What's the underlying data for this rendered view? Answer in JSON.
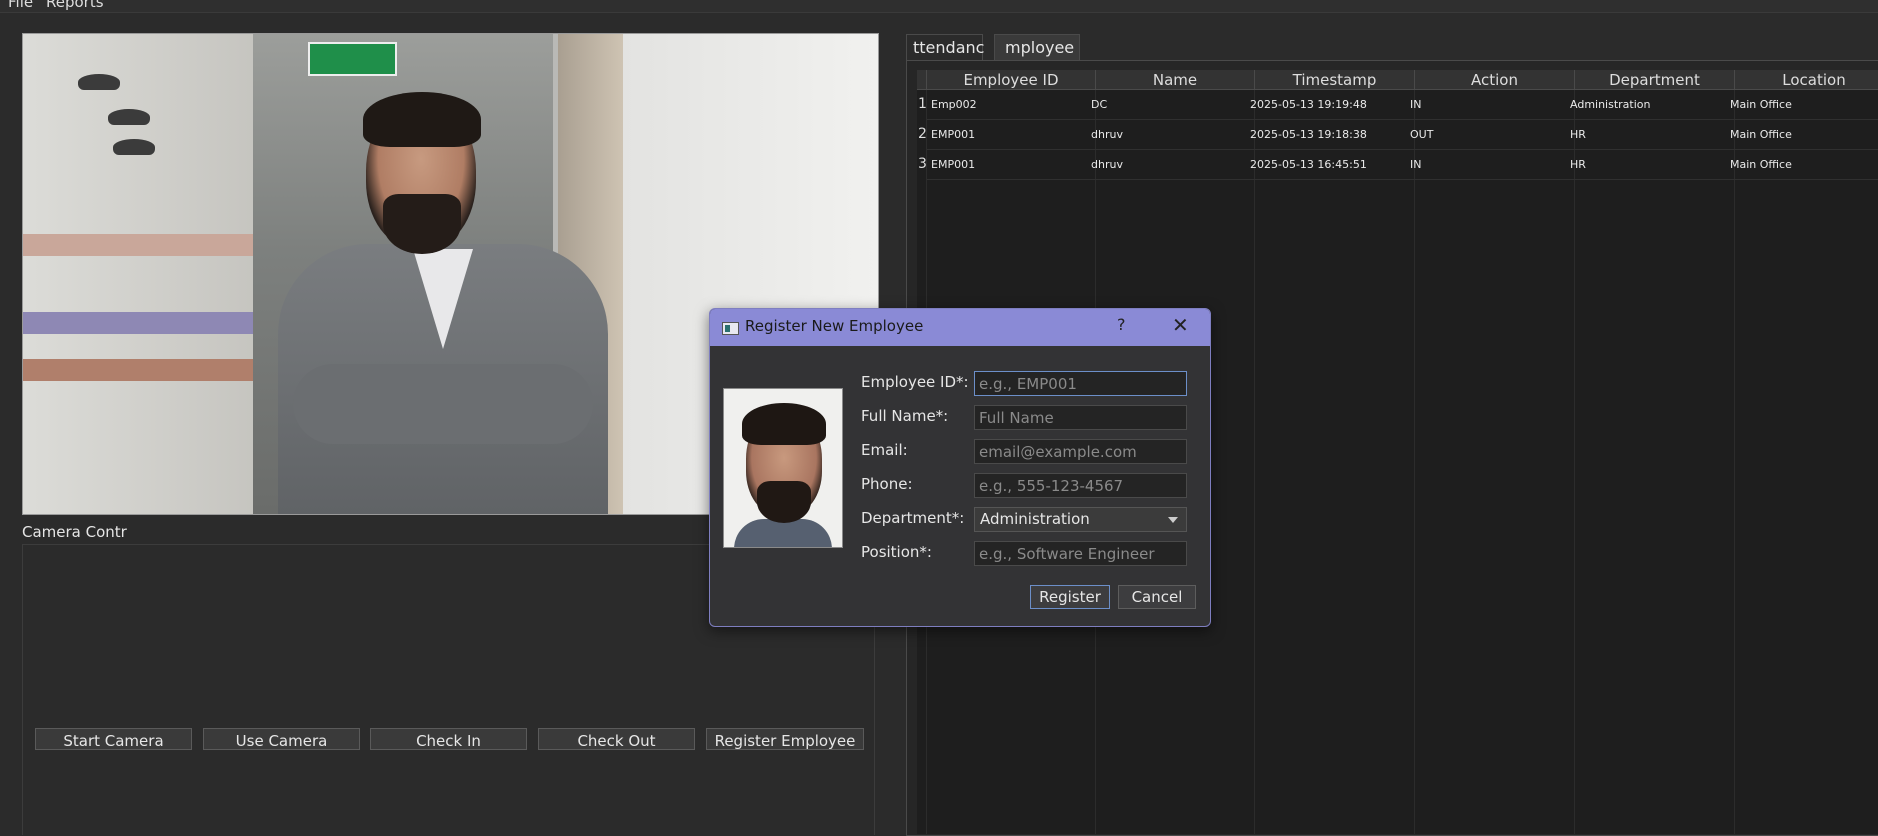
{
  "menu": {
    "items": [
      "File",
      "Reports"
    ]
  },
  "camera_panel": {
    "label": "Camera Contr",
    "buttons": [
      "Start Camera",
      "Use Camera",
      "Check In",
      "Check Out",
      "Register Employee"
    ]
  },
  "tabs": [
    "ttendanc",
    "mployee"
  ],
  "table": {
    "columns": [
      "Employee ID",
      "Name",
      "Timestamp",
      "Action",
      "Department",
      "Location"
    ],
    "rows": [
      {
        "num": "1",
        "cells": [
          "Emp002",
          "DC",
          "2025-05-13 19:19:48",
          "IN",
          "Administration",
          "Main Office"
        ]
      },
      {
        "num": "2",
        "cells": [
          "EMP001",
          "dhruv",
          "2025-05-13 19:18:38",
          "OUT",
          "HR",
          "Main Office"
        ]
      },
      {
        "num": "3",
        "cells": [
          "EMP001",
          "dhruv",
          "2025-05-13 16:45:51",
          "IN",
          "HR",
          "Main Office"
        ]
      }
    ]
  },
  "dialog": {
    "title": "Register New Employee",
    "help": "?",
    "close": "✕",
    "fields": {
      "employee_id": {
        "label": "Employee ID*:",
        "placeholder": "e.g., EMP001"
      },
      "full_name": {
        "label": "Full Name*:",
        "placeholder": "Full Name"
      },
      "email": {
        "label": "Email:",
        "placeholder": "email@example.com"
      },
      "phone": {
        "label": "Phone:",
        "placeholder": "e.g., 555-123-4567"
      },
      "department": {
        "label": "Department*:",
        "value": "Administration"
      },
      "position": {
        "label": "Position*:",
        "placeholder": "e.g., Software Engineer"
      }
    },
    "buttons": {
      "register": "Register",
      "cancel": "Cancel"
    }
  },
  "colors": {
    "titlebar": "#8a8ad6",
    "focus_border": "#6c8fc9",
    "background": "#2b2b2b"
  }
}
